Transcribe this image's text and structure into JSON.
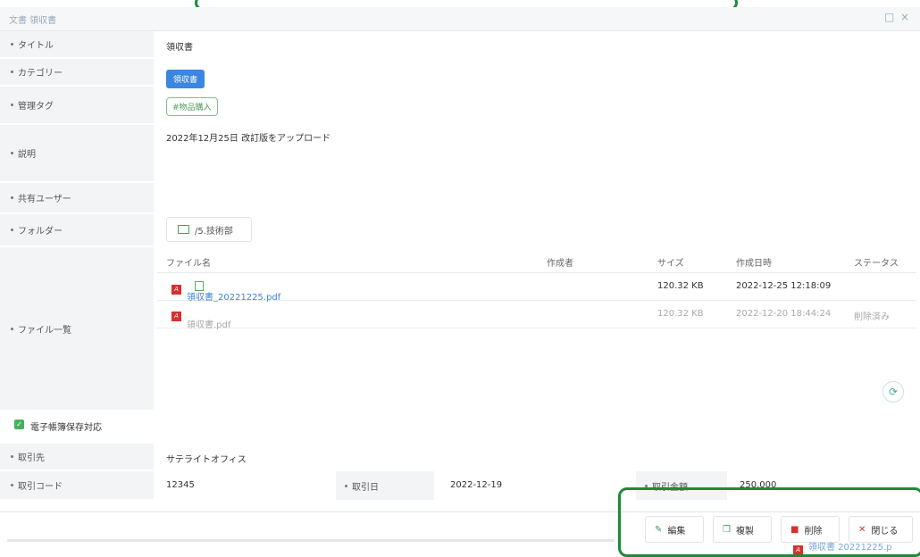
{
  "window": {
    "title": "文書 領収書",
    "maximize_icon": "□",
    "close_icon": "×"
  },
  "fields": {
    "title_label": "タイトル",
    "title_value": "領収書",
    "category_label": "カテゴリー",
    "category_value": "領収書",
    "tag_label": "管理タグ",
    "tag_value": "#物品購入",
    "desc_label": "説明",
    "desc_value": "2022年12月25日 改訂版をアップロード",
    "shared_label": "共有ユーザー",
    "folder_label": "フォルダー",
    "folder_value": "/5.技術部",
    "filelist_label": "ファイル一覧"
  },
  "files": {
    "headers": {
      "name": "ファイル名",
      "author": "作成者",
      "size": "サイズ",
      "created": "作成日時",
      "status": "ステータス"
    },
    "rows": [
      {
        "name": "領収書_20221225.pdf",
        "author": "",
        "size": "120.32 KB",
        "created": "2022-12-25 12:18:09",
        "status": ""
      },
      {
        "name": "領収書.pdf",
        "author": "",
        "size": "120.32 KB",
        "created": "2022-12-20 18:44:24",
        "status": "削除済み"
      }
    ]
  },
  "ebook": {
    "checked": true,
    "label": "電子帳簿保存対応"
  },
  "trade": {
    "partner_label": "取引先",
    "partner_value": "サテライトオフィス",
    "code_label": "取引コード",
    "code_value": "12345",
    "date_label": "取引日",
    "date_value": "2022-12-19",
    "amount_label": "取引金額",
    "amount_value": "250,000"
  },
  "buttons": {
    "edit": "編集",
    "copy": "複製",
    "delete": "削除",
    "close": "閉じる"
  },
  "peek_text": "領収書 20221225.p",
  "colors": {
    "accent_blue": "#3b86e0",
    "tag_green": "#4c9b5d",
    "highlight": "#1e8a3a",
    "pdf_red": "#d8302c"
  }
}
